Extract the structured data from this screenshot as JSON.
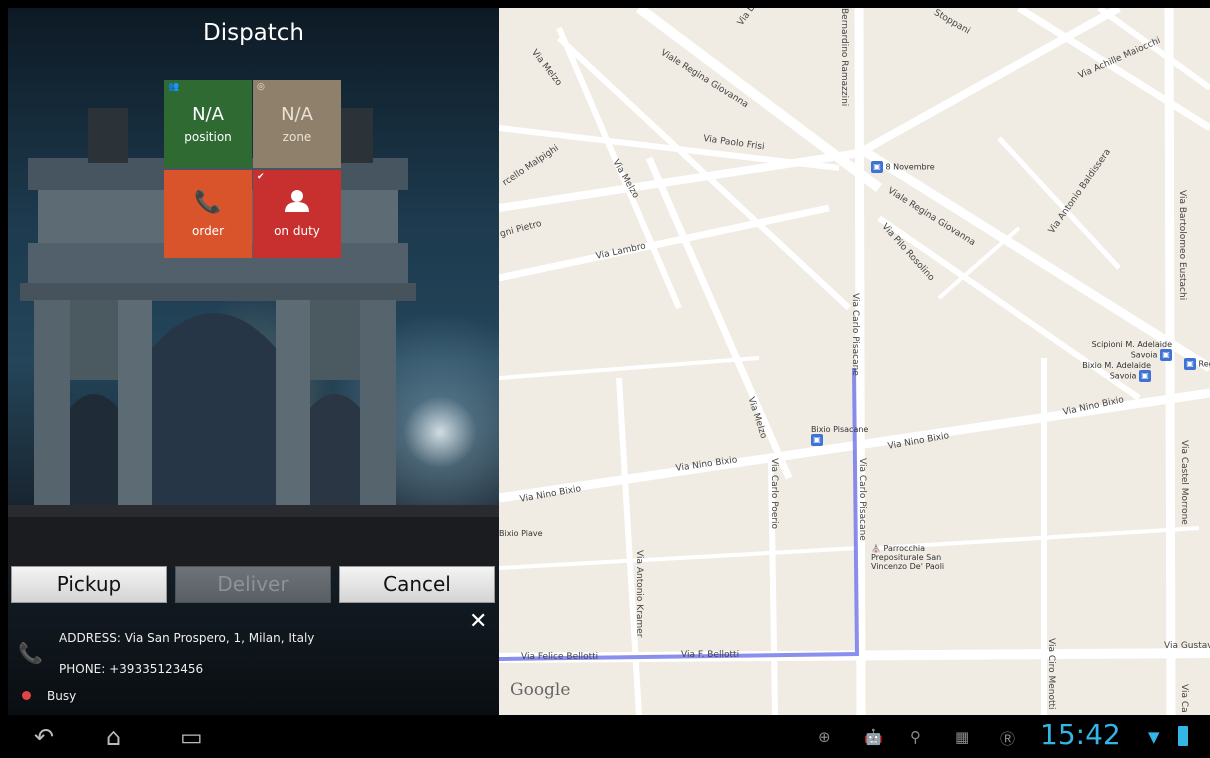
{
  "app": {
    "title": "Dispatch"
  },
  "tiles": {
    "position": {
      "value": "N/A",
      "label": "position",
      "color": "#2e6a32"
    },
    "zone": {
      "value": "N/A",
      "label": "zone",
      "color": "#8e806a"
    },
    "order": {
      "label": "order",
      "color": "#d9542b"
    },
    "duty": {
      "label": "on duty",
      "color": "#c83030"
    }
  },
  "actions": {
    "pickup": "Pickup",
    "deliver": "Deliver",
    "cancel": "Cancel"
  },
  "info": {
    "address": "ADDRESS: Via San Prospero, 1, Milan, Italy",
    "phone": "PHONE: +39335123456",
    "status": "Busy"
  },
  "map": {
    "streets": [
      "Via Le",
      "Stoppani",
      "Bernardino Ramazzini",
      "Via Achille Maiocchi",
      "Via Melzo",
      "Viale Regina Giovanna",
      "Via Paolo Frisi",
      "rcello Malpighi",
      "Via Melzo",
      "gni Pietro",
      "Via Lambro",
      "Viale Regina Giovanna",
      "Via Pilo Rosolino",
      "Via Antonio Baldissera",
      "Via Bartolomeo Eustachi",
      "Via Carlo Pisacane",
      "Via Nino Bixio",
      "Via Nino Bixio",
      "Via Melzo",
      "Via Nino Bixio",
      "Via Nino Bixio",
      "Via Carlo Poerio",
      "Via Carlo Pisacane",
      "Via Castel Morrone",
      "Via Antonio Kramer",
      "Via Felice Bellotti",
      "Via F. Bellotti",
      "Via Ciro Menotti",
      "Via Gustavo",
      "Via Ca"
    ],
    "pois": [
      "8 Novembre",
      "Scipioni M. Adelaide Savoia",
      "Bixio M. Adelaide Savoia",
      "Reg. Adel",
      "Bixio Pisacane",
      "Bixio Piave",
      "Parrocchia Prepositurale San Vincenzo De' Paoli"
    ],
    "attribution": "Google",
    "route_color": "#6d72e8"
  },
  "status_bar": {
    "time": "15:42"
  }
}
